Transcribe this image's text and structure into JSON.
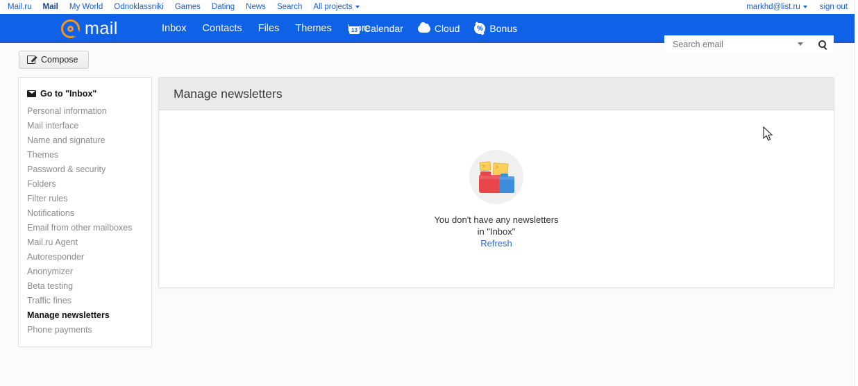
{
  "portal": {
    "links": [
      {
        "label": "Mail.ru",
        "bold": false
      },
      {
        "label": "Mail",
        "bold": true
      },
      {
        "label": "My World",
        "bold": false
      },
      {
        "label": "Odnoklassniki",
        "bold": false
      },
      {
        "label": "Games",
        "bold": false
      },
      {
        "label": "Dating",
        "bold": false
      },
      {
        "label": "News",
        "bold": false
      },
      {
        "label": "Search",
        "bold": false
      },
      {
        "label": "All projects",
        "bold": false
      }
    ],
    "account": "markhd@list.ru",
    "sign_out": "sign out"
  },
  "header": {
    "logo_text": "mail",
    "logo_icon": "at-sign-icon",
    "nav": [
      "Inbox",
      "Contacts",
      "Files",
      "Themes",
      "More"
    ],
    "services": [
      {
        "label": "Calendar",
        "icon": "calendar-icon",
        "day": "13"
      },
      {
        "label": "Cloud",
        "icon": "cloud-icon"
      },
      {
        "label": "Bonus",
        "icon": "bonus-percent-icon"
      }
    ],
    "search": {
      "placeholder": "Search email",
      "value": "",
      "dropdown_icon": "chevron-down-icon",
      "submit_icon": "search-icon"
    },
    "accent_blue": "#0f62e8",
    "logo_orange": "#f4951f"
  },
  "toolbar": {
    "compose_label": "Compose",
    "compose_icon": "edit-square-icon"
  },
  "sidebar": {
    "inbox_link": "Go to \"Inbox\"",
    "inbox_icon": "envelope-icon",
    "items": [
      {
        "label": "Personal information",
        "active": false
      },
      {
        "label": "Mail interface",
        "active": false
      },
      {
        "label": "Name and signature",
        "active": false
      },
      {
        "label": "Themes",
        "active": false
      },
      {
        "label": "Password & security",
        "active": false
      },
      {
        "label": "Folders",
        "active": false
      },
      {
        "label": "Filter rules",
        "active": false
      },
      {
        "label": "Notifications",
        "active": false
      },
      {
        "label": "Email from other mailboxes",
        "active": false
      },
      {
        "label": "Mail.ru Agent",
        "active": false
      },
      {
        "label": "Autoresponder",
        "active": false
      },
      {
        "label": "Anonymizer",
        "active": false
      },
      {
        "label": "Beta testing",
        "active": false
      },
      {
        "label": "Traffic fines",
        "active": false
      },
      {
        "label": "Manage newsletters",
        "active": true
      },
      {
        "label": "Phone payments",
        "active": false
      }
    ]
  },
  "main": {
    "title": "Manage newsletters",
    "empty_state": {
      "illustration": "folders-and-envelopes-icon",
      "line1": "You don't have any newsletters",
      "line2": "in \"Inbox\"",
      "refresh_label": "Refresh",
      "link_color": "#2b6cc4"
    }
  }
}
